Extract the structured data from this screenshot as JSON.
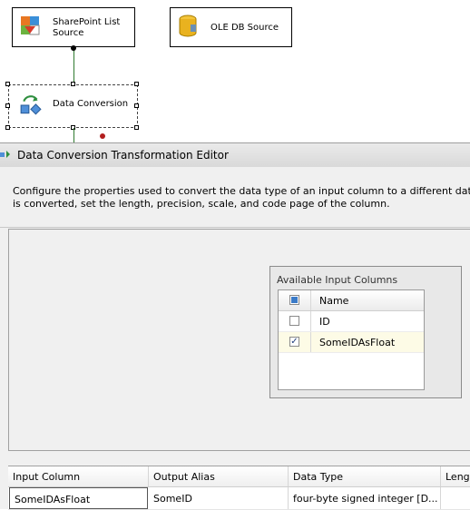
{
  "designer": {
    "tasks": [
      {
        "label": "SharePoint List Source",
        "icon": "sharepoint-list-source-icon"
      },
      {
        "label": "OLE DB Source",
        "icon": "database-cylinder-icon"
      },
      {
        "label": "Data Conversion",
        "icon": "data-conversion-icon"
      }
    ]
  },
  "editor": {
    "title": "Data Conversion Transformation Editor",
    "description_line1": "Configure the properties used to convert the data type of an input column to a different data typ",
    "description_line2": "is converted, set the length, precision, scale, and code page of the column.",
    "available_columns": {
      "title": "Available Input Columns",
      "header": "Name",
      "rows": [
        {
          "name": "ID",
          "checked": false
        },
        {
          "name": "SomeIDAsFloat",
          "checked": true
        }
      ]
    },
    "mapping_grid": {
      "headers": [
        "Input Column",
        "Output Alias",
        "Data Type",
        "Leng"
      ],
      "rows": [
        [
          "SomeIDAsFloat",
          "SomeID",
          "four-byte signed integer [D...",
          ""
        ]
      ]
    }
  },
  "colors": {
    "connector": "#2f7a2f",
    "selected_row": "#fdfbe6",
    "window_bg": "#f0f0f0"
  }
}
